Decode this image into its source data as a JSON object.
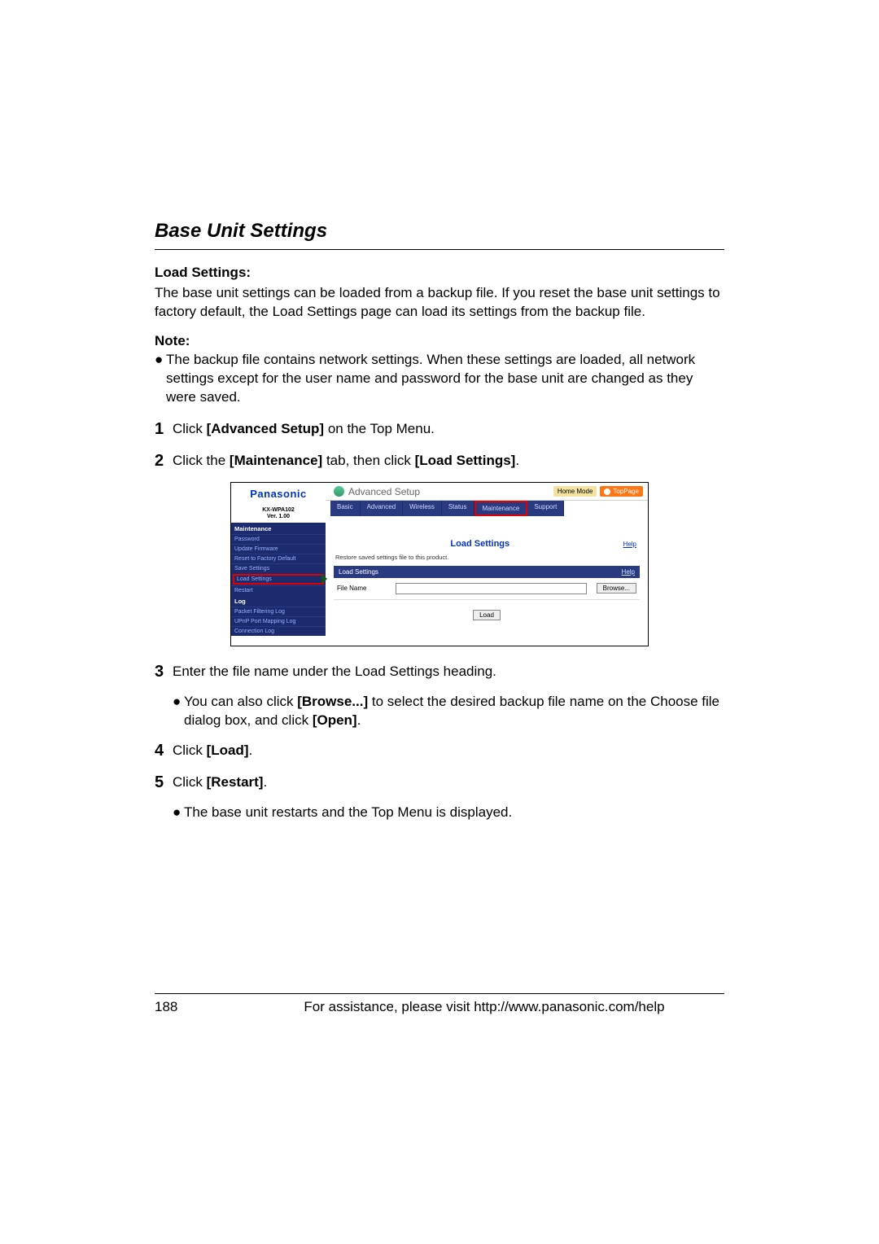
{
  "title": "Base Unit Settings",
  "load_section": {
    "heading": "Load Settings:",
    "text": "The base unit settings can be loaded from a backup file. If you reset the base unit settings to factory default, the Load Settings page can load its settings from the backup file."
  },
  "note": {
    "label": "Note:",
    "text": "The backup file contains network settings. When these settings are loaded, all network settings except for the user name and password for the base unit are changed as they were saved."
  },
  "steps": {
    "s1_pre": "Click ",
    "s1_bold": "[Advanced Setup]",
    "s1_post": " on the Top Menu.",
    "s2_pre": "Click the ",
    "s2_b1": "[Maintenance]",
    "s2_mid": " tab, then click ",
    "s2_b2": "[Load Settings]",
    "s2_post": ".",
    "s3": "Enter the file name under the Load Settings heading.",
    "s3_sub_pre": "You can also click ",
    "s3_sub_b1": "[Browse...]",
    "s3_sub_mid": " to select the desired backup file name on the Choose file dialog box, and click ",
    "s3_sub_b2": "[Open]",
    "s3_sub_post": ".",
    "s4_pre": "Click ",
    "s4_b": "[Load]",
    "s4_post": ".",
    "s5_pre": "Click ",
    "s5_b": "[Restart]",
    "s5_post": ".",
    "s5_sub": "The base unit restarts and the Top Menu is displayed."
  },
  "figure": {
    "brand": "Panasonic",
    "model": "KX-WPA102",
    "version": "Ver. 1.00",
    "nav_header_maint": "Maintenance",
    "nav_items": [
      "Password",
      "Update Firmware",
      "Reset to Factory Default",
      "Save Settings",
      "Load Settings",
      "Restart"
    ],
    "nav_header_log": "Log",
    "log_items": [
      "Packet Filtering Log",
      "UPnP Port Mapping Log",
      "Connection Log"
    ],
    "adv_setup": "Advanced Setup",
    "mode": "Home Mode",
    "top_page": "TopPage",
    "tabs": [
      "Basic",
      "Advanced",
      "Wireless",
      "Status",
      "Maintenance",
      "Support"
    ],
    "panel_title": "Load Settings",
    "help": "Help",
    "panel_desc": "Restore saved settings file to this product.",
    "sub_band": "Load Settings",
    "file_label": "File Name",
    "browse": "Browse...",
    "load": "Load"
  },
  "footer": {
    "page": "188",
    "assist": "For assistance, please visit http://www.panasonic.com/help"
  },
  "nums": {
    "n1": "1",
    "n2": "2",
    "n3": "3",
    "n4": "4",
    "n5": "5"
  },
  "bullet": "●"
}
